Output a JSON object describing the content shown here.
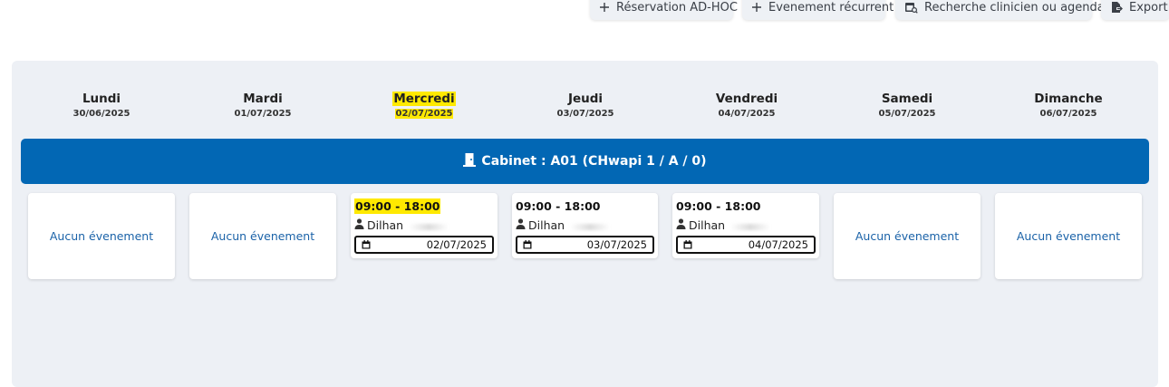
{
  "toolbar": {
    "buttons": [
      {
        "label": "Réservation AD-HOC",
        "icon": "plus-icon"
      },
      {
        "label": "Evenement récurrent",
        "icon": "plus-icon"
      },
      {
        "label": "Recherche clinicien ou agenda",
        "icon": "calendar-search-icon"
      },
      {
        "label": "Export",
        "icon": "export-icon"
      }
    ]
  },
  "week": {
    "days": [
      {
        "name": "Lundi",
        "date": "30/06/2025",
        "highlighted": false
      },
      {
        "name": "Mardi",
        "date": "01/07/2025",
        "highlighted": false
      },
      {
        "name": "Mercredi",
        "date": "02/07/2025",
        "highlighted": true
      },
      {
        "name": "Jeudi",
        "date": "03/07/2025",
        "highlighted": false
      },
      {
        "name": "Vendredi",
        "date": "04/07/2025",
        "highlighted": false
      },
      {
        "name": "Samedi",
        "date": "05/07/2025",
        "highlighted": false
      },
      {
        "name": "Dimanche",
        "date": "06/07/2025",
        "highlighted": false
      }
    ]
  },
  "cabinet": {
    "label": "Cabinet : A01 (CHwapi 1 / A / 0)",
    "icon": "door-icon",
    "color": "#0267b4"
  },
  "events": {
    "empty_label": "Aucun évenement",
    "cells": [
      {
        "type": "empty"
      },
      {
        "type": "empty"
      },
      {
        "type": "event",
        "time": "09:00 - 18:00",
        "person": "Dilhan",
        "date": "02/07/2025",
        "time_highlighted": true
      },
      {
        "type": "event",
        "time": "09:00 - 18:00",
        "person": "Dilhan",
        "date": "03/07/2025",
        "time_highlighted": false
      },
      {
        "type": "event",
        "time": "09:00 - 18:00",
        "person": "Dilhan",
        "date": "04/07/2025",
        "time_highlighted": false
      },
      {
        "type": "empty"
      },
      {
        "type": "empty"
      }
    ]
  },
  "colors": {
    "highlight": "#ffe900",
    "panel_bg": "#edf0f5",
    "link_blue": "#1a62a8"
  }
}
